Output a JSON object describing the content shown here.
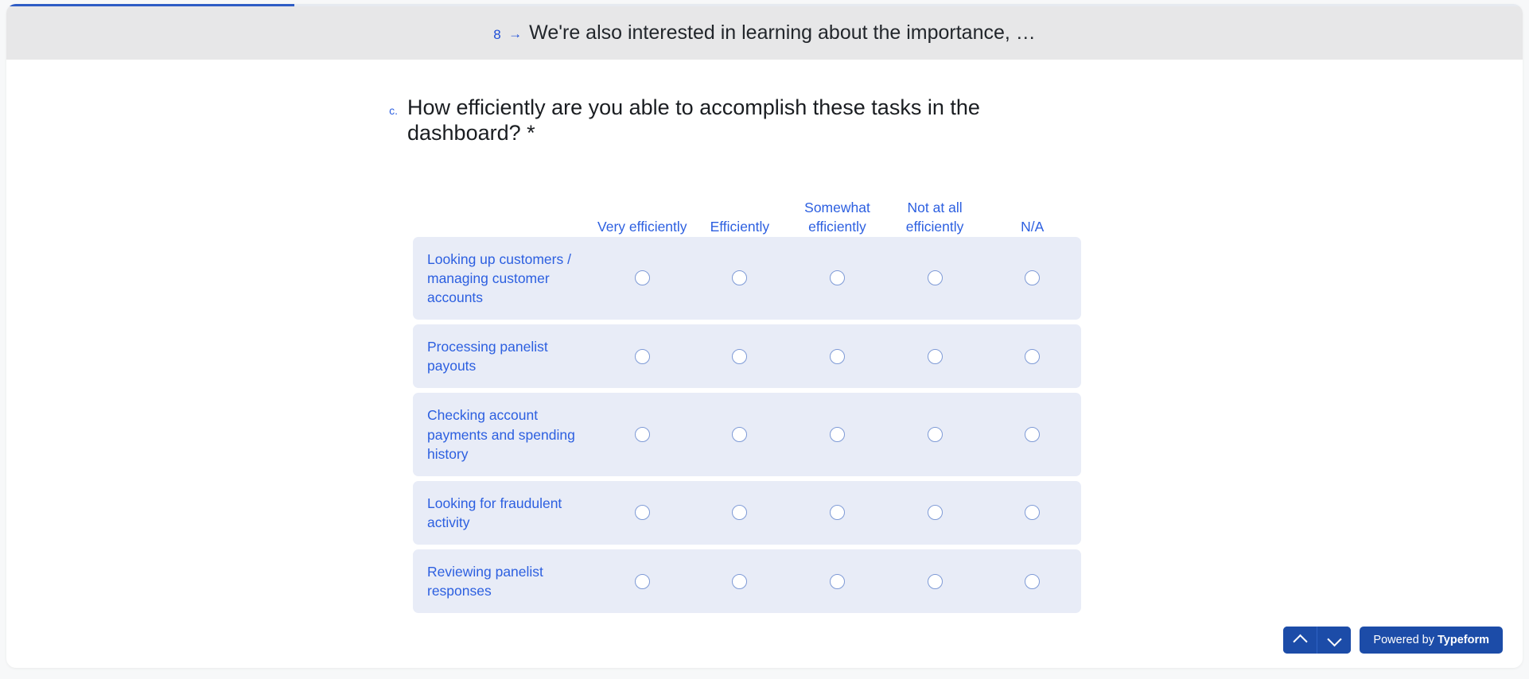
{
  "banner": {
    "number": "8",
    "arrow_icon": "arrow-right-icon",
    "text": "We're also interested in learning about the importance, …"
  },
  "progress": {
    "percent": 19
  },
  "question": {
    "letter": "c.",
    "title": "How efficiently are you able to accomplish these tasks in the dashboard? *",
    "required_marker": "*"
  },
  "matrix": {
    "columns": [
      "Very efficiently",
      "Efficiently",
      "Somewhat efficiently",
      "Not at all efficiently",
      "N/A"
    ],
    "rows": [
      {
        "label": "Looking up customers / managing customer accounts",
        "selected": null
      },
      {
        "label": "Processing panelist payouts",
        "selected": null
      },
      {
        "label": "Checking account payments and spending history",
        "selected": null
      },
      {
        "label": "Looking for fraudulent activity",
        "selected": null
      },
      {
        "label": "Reviewing panelist responses",
        "selected": null
      }
    ]
  },
  "footer": {
    "nav_up_icon": "chevron-up-icon",
    "nav_down_icon": "chevron-down-icon",
    "brand_prefix": "Powered by",
    "brand_name": "Typeform"
  },
  "colors": {
    "accent": "#2c5fe0",
    "brand_button": "#1c4ca8",
    "row_background": "#e8ecf7",
    "banner_background": "#e7e7e8"
  }
}
